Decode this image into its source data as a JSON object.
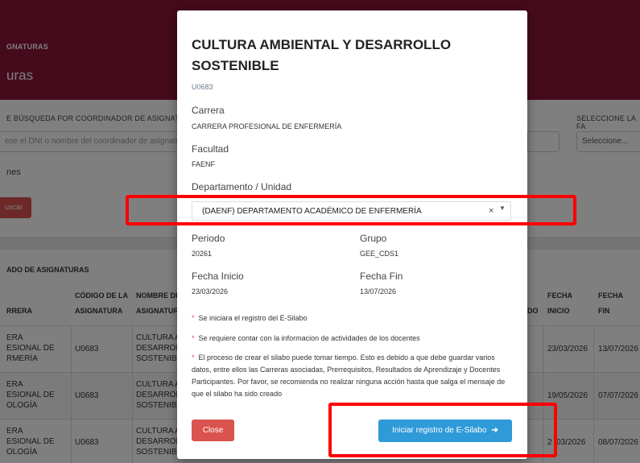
{
  "page": {
    "breadcrumb": "GNATURAS",
    "title": "uras",
    "filters": {
      "coordinator_label": "E BÚSQUEDA POR COORDINADOR DE ASIGNATU",
      "coordinator_placeholder": "ese el DNI o nombre del coordinador de asignatu",
      "faculty_label": "SELECCIONE LA FA",
      "faculty_select": "Seleccione...",
      "options_text": "nes",
      "search_button": "uscar"
    },
    "table": {
      "title": "ADO DE ASIGNATURAS",
      "headers": {
        "carrera": "RRERA",
        "codigo": [
          "CÓDIGO DE LA",
          "ASIGNATURA"
        ],
        "nombre": [
          "NOMBRE DE",
          "ASIGNATUR"
        ],
        "do": "DO",
        "fecha_inicio": [
          "FECHA",
          "INICIO"
        ],
        "fecha_fin": [
          "FECHA",
          "FIN"
        ]
      },
      "rows": [
        {
          "carrera": [
            "ERA",
            "ESIONAL DE",
            "RMERÍA"
          ],
          "codigo": "U0683",
          "nombre": [
            "CULTURA A",
            "DESARROLL",
            "SOSTENIBL"
          ],
          "inicio": "23/03/2026",
          "fin": "13/07/2026"
        },
        {
          "carrera": [
            "ERA",
            "ESIONAL DE",
            "OLOGÍA"
          ],
          "codigo": "U0683",
          "nombre": [
            "CULTURA A",
            "DESARROLL",
            "SOSTENIBL"
          ],
          "inicio": "19/05/2026",
          "fin": "07/07/2026"
        },
        {
          "carrera": [
            "ERA",
            "ESIONAL DE",
            "OLOGÍA"
          ],
          "codigo": "U0683",
          "nombre": [
            "CULTURA A",
            "DESARROLL",
            "SOSTENIBL"
          ],
          "inicio": "2 /03/2026",
          "fin": "08/07/2026"
        }
      ]
    }
  },
  "modal": {
    "title": "CULTURA AMBIENTAL Y DESARROLLO SOSTENIBLE",
    "code": "U0683",
    "carrera_label": "Carrera",
    "carrera_value": "CARRERA PROFESIONAL DE ENFERMERÍA",
    "facultad_label": "Facultad",
    "facultad_value": "FAENF",
    "departamento_label": "Departamento / Unidad",
    "departamento_value": "(DAENF) DEPARTAMENTO ACADÉMICO DE ENFERMERÍA",
    "periodo_label": "Periodo",
    "periodo_value": "20261",
    "grupo_label": "Grupo",
    "grupo_value": "GEE_CDS1",
    "fecha_inicio_label": "Fecha Inicio",
    "fecha_inicio_value": "23/03/2026",
    "fecha_fin_label": "Fecha Fin",
    "fecha_fin_value": "13/07/2026",
    "notes": [
      "Se iniciara el registro del E-Silabo",
      "Se requiere contar con la informacion de actividades de los docentes",
      "El proceso de crear el silabo puede tomar tiempo. Esto es debido a que debe guardar varios datos, entre ellos las Carreras asociadas, Prerrequisitos, Resultados de Aprendizaje y Docentes Participantes. Por favor, se recomienda no realizar ninguna acción hasta que salga el mensaje de que el silabo ha sido creado"
    ],
    "note_marker": "*",
    "close_button": "Close",
    "start_button": "Iniciar registro de E-Silabo",
    "start_icon": "arrow-right-icon",
    "clear_glyph": "×",
    "dropdown_glyph": "▼"
  },
  "colors": {
    "brand": "#8b1538",
    "danger": "#d9534f",
    "primary": "#2e9ad8",
    "highlight": "#ff0000"
  }
}
